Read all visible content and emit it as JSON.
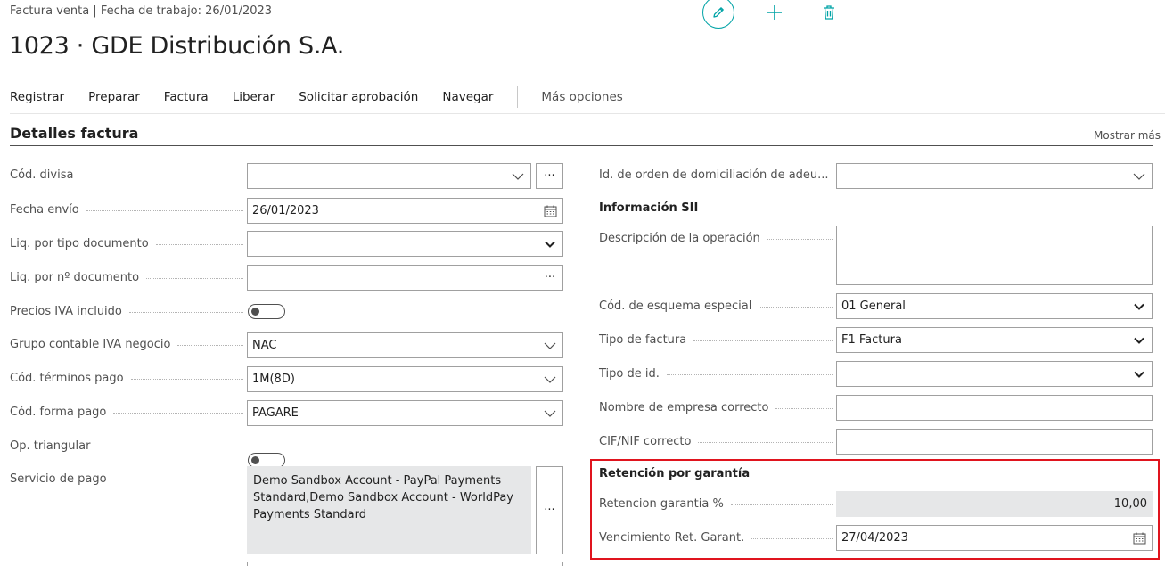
{
  "header": {
    "breadcrumb": "Factura venta | Fecha de trabajo: 26/01/2023",
    "title": "1023 · GDE Distribución S.A.",
    "accent_color": "#00a3a6"
  },
  "actions": {
    "items": [
      "Registrar",
      "Preparar",
      "Factura",
      "Liberar",
      "Solicitar aprobación",
      "Navegar"
    ],
    "more": "Más opciones"
  },
  "section": {
    "title": "Detalles factura",
    "show_more": "Mostrar más"
  },
  "left_fields": {
    "cod_divisa": {
      "label": "Cód. divisa",
      "value": ""
    },
    "fecha_envio": {
      "label": "Fecha envío",
      "value": "26/01/2023"
    },
    "liq_tipo_doc": {
      "label": "Liq. por tipo documento",
      "value": ""
    },
    "liq_num_doc": {
      "label": "Liq. por nº documento",
      "value": ""
    },
    "precios_iva": {
      "label": "Precios IVA incluido",
      "value": "off"
    },
    "grupo_iva": {
      "label": "Grupo contable IVA negocio",
      "value": "NAC"
    },
    "terminos_pago": {
      "label": "Cód. términos pago",
      "value": "1M(8D)"
    },
    "forma_pago": {
      "label": "Cód. forma pago",
      "value": "PAGARE"
    },
    "op_triangular": {
      "label": "Op. triangular",
      "value": "off"
    },
    "servicio_pago": {
      "label": "Servicio de pago",
      "value": "Demo Sandbox Account - PayPal Payments Standard,Demo Sandbox Account - WorldPay Payments Standard"
    }
  },
  "right_fields": {
    "id_orden": {
      "label": "Id. de orden de domiciliación de adeu...",
      "value": ""
    },
    "sii_heading": "Información SII",
    "descripcion": {
      "label": "Descripción de la operación",
      "value": ""
    },
    "esquema": {
      "label": "Cód. de esquema especial",
      "value": "01 General"
    },
    "tipo_factura": {
      "label": "Tipo de factura",
      "value": "F1 Factura"
    },
    "tipo_id": {
      "label": "Tipo de id.",
      "value": ""
    },
    "nombre_empresa": {
      "label": "Nombre de empresa correcto",
      "value": ""
    },
    "cif_nif": {
      "label": "CIF/NIF correcto",
      "value": ""
    },
    "retencion_heading": "Retención por garantía",
    "retencion_pct": {
      "label": "Retencion garantia %",
      "value": "10,00"
    },
    "vencimiento": {
      "label": "Vencimiento Ret. Garant.",
      "value": "27/04/2023"
    }
  },
  "ellipsis_glyph": "···",
  "highlight_color": "#e0141e"
}
